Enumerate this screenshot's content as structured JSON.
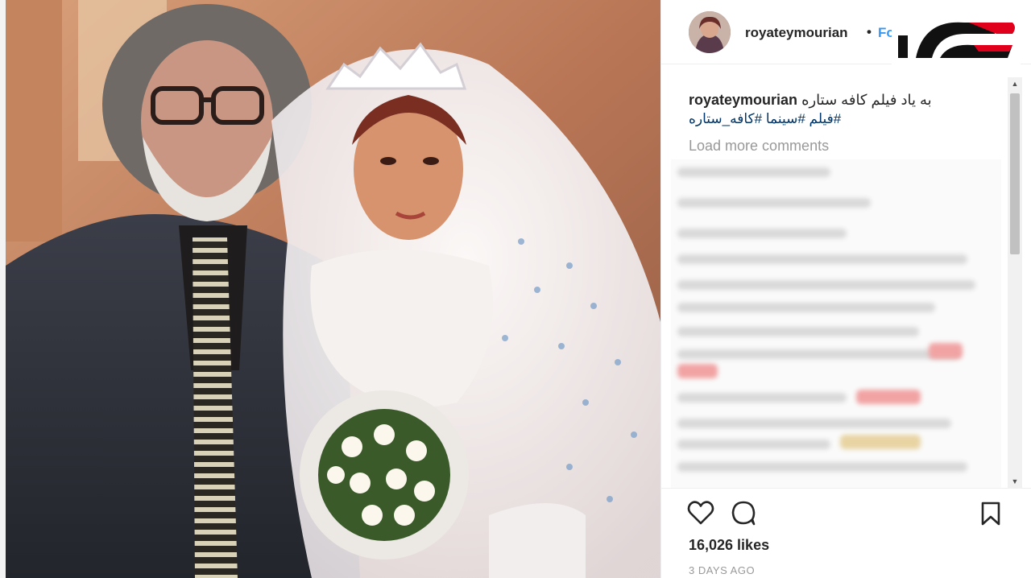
{
  "post": {
    "username": "royateymourian",
    "dot": "•",
    "follow_label": "Follow",
    "caption_user": "royateymourian",
    "caption_text": "به یاد فیلم کافه ستاره",
    "hashtags": "#فیلم #سینما #کافه_ستاره",
    "load_more": "Load more comments",
    "likes": "16,026 likes",
    "time": "3 DAYS AGO"
  },
  "icons": {
    "like": "heart-icon",
    "comment": "comment-icon",
    "save": "bookmark-icon",
    "scroll_up": "arrow-up-icon",
    "scroll_down": "arrow-down-icon"
  },
  "colors": {
    "link_blue": "#3897f0",
    "hashtag_blue": "#003569",
    "logo_red": "#e0001b",
    "text_dark": "#262626",
    "text_muted": "#999999"
  }
}
